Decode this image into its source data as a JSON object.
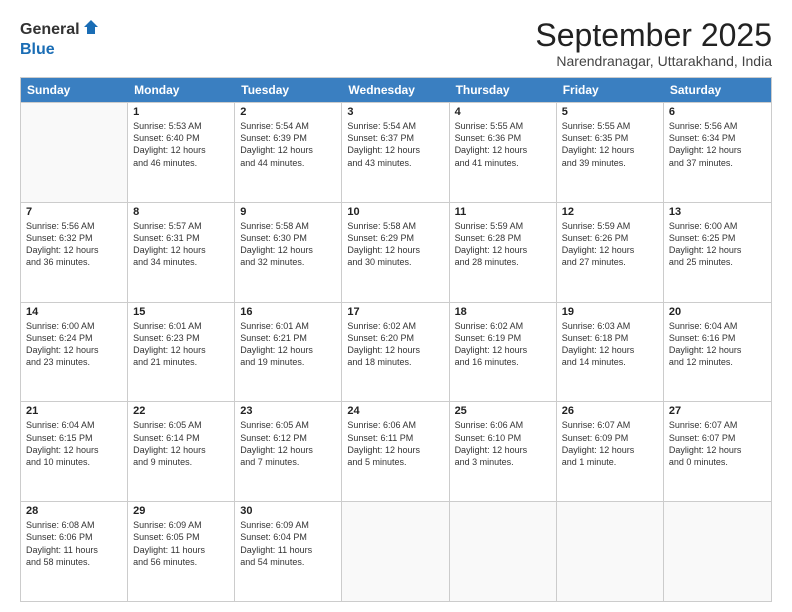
{
  "logo": {
    "general": "General",
    "blue": "Blue"
  },
  "title": "September 2025",
  "location": "Narendranagar, Uttarakhand, India",
  "headers": [
    "Sunday",
    "Monday",
    "Tuesday",
    "Wednesday",
    "Thursday",
    "Friday",
    "Saturday"
  ],
  "weeks": [
    [
      {
        "day": "",
        "info": ""
      },
      {
        "day": "1",
        "info": "Sunrise: 5:53 AM\nSunset: 6:40 PM\nDaylight: 12 hours\nand 46 minutes."
      },
      {
        "day": "2",
        "info": "Sunrise: 5:54 AM\nSunset: 6:39 PM\nDaylight: 12 hours\nand 44 minutes."
      },
      {
        "day": "3",
        "info": "Sunrise: 5:54 AM\nSunset: 6:37 PM\nDaylight: 12 hours\nand 43 minutes."
      },
      {
        "day": "4",
        "info": "Sunrise: 5:55 AM\nSunset: 6:36 PM\nDaylight: 12 hours\nand 41 minutes."
      },
      {
        "day": "5",
        "info": "Sunrise: 5:55 AM\nSunset: 6:35 PM\nDaylight: 12 hours\nand 39 minutes."
      },
      {
        "day": "6",
        "info": "Sunrise: 5:56 AM\nSunset: 6:34 PM\nDaylight: 12 hours\nand 37 minutes."
      }
    ],
    [
      {
        "day": "7",
        "info": "Sunrise: 5:56 AM\nSunset: 6:32 PM\nDaylight: 12 hours\nand 36 minutes."
      },
      {
        "day": "8",
        "info": "Sunrise: 5:57 AM\nSunset: 6:31 PM\nDaylight: 12 hours\nand 34 minutes."
      },
      {
        "day": "9",
        "info": "Sunrise: 5:58 AM\nSunset: 6:30 PM\nDaylight: 12 hours\nand 32 minutes."
      },
      {
        "day": "10",
        "info": "Sunrise: 5:58 AM\nSunset: 6:29 PM\nDaylight: 12 hours\nand 30 minutes."
      },
      {
        "day": "11",
        "info": "Sunrise: 5:59 AM\nSunset: 6:28 PM\nDaylight: 12 hours\nand 28 minutes."
      },
      {
        "day": "12",
        "info": "Sunrise: 5:59 AM\nSunset: 6:26 PM\nDaylight: 12 hours\nand 27 minutes."
      },
      {
        "day": "13",
        "info": "Sunrise: 6:00 AM\nSunset: 6:25 PM\nDaylight: 12 hours\nand 25 minutes."
      }
    ],
    [
      {
        "day": "14",
        "info": "Sunrise: 6:00 AM\nSunset: 6:24 PM\nDaylight: 12 hours\nand 23 minutes."
      },
      {
        "day": "15",
        "info": "Sunrise: 6:01 AM\nSunset: 6:23 PM\nDaylight: 12 hours\nand 21 minutes."
      },
      {
        "day": "16",
        "info": "Sunrise: 6:01 AM\nSunset: 6:21 PM\nDaylight: 12 hours\nand 19 minutes."
      },
      {
        "day": "17",
        "info": "Sunrise: 6:02 AM\nSunset: 6:20 PM\nDaylight: 12 hours\nand 18 minutes."
      },
      {
        "day": "18",
        "info": "Sunrise: 6:02 AM\nSunset: 6:19 PM\nDaylight: 12 hours\nand 16 minutes."
      },
      {
        "day": "19",
        "info": "Sunrise: 6:03 AM\nSunset: 6:18 PM\nDaylight: 12 hours\nand 14 minutes."
      },
      {
        "day": "20",
        "info": "Sunrise: 6:04 AM\nSunset: 6:16 PM\nDaylight: 12 hours\nand 12 minutes."
      }
    ],
    [
      {
        "day": "21",
        "info": "Sunrise: 6:04 AM\nSunset: 6:15 PM\nDaylight: 12 hours\nand 10 minutes."
      },
      {
        "day": "22",
        "info": "Sunrise: 6:05 AM\nSunset: 6:14 PM\nDaylight: 12 hours\nand 9 minutes."
      },
      {
        "day": "23",
        "info": "Sunrise: 6:05 AM\nSunset: 6:12 PM\nDaylight: 12 hours\nand 7 minutes."
      },
      {
        "day": "24",
        "info": "Sunrise: 6:06 AM\nSunset: 6:11 PM\nDaylight: 12 hours\nand 5 minutes."
      },
      {
        "day": "25",
        "info": "Sunrise: 6:06 AM\nSunset: 6:10 PM\nDaylight: 12 hours\nand 3 minutes."
      },
      {
        "day": "26",
        "info": "Sunrise: 6:07 AM\nSunset: 6:09 PM\nDaylight: 12 hours\nand 1 minute."
      },
      {
        "day": "27",
        "info": "Sunrise: 6:07 AM\nSunset: 6:07 PM\nDaylight: 12 hours\nand 0 minutes."
      }
    ],
    [
      {
        "day": "28",
        "info": "Sunrise: 6:08 AM\nSunset: 6:06 PM\nDaylight: 11 hours\nand 58 minutes."
      },
      {
        "day": "29",
        "info": "Sunrise: 6:09 AM\nSunset: 6:05 PM\nDaylight: 11 hours\nand 56 minutes."
      },
      {
        "day": "30",
        "info": "Sunrise: 6:09 AM\nSunset: 6:04 PM\nDaylight: 11 hours\nand 54 minutes."
      },
      {
        "day": "",
        "info": ""
      },
      {
        "day": "",
        "info": ""
      },
      {
        "day": "",
        "info": ""
      },
      {
        "day": "",
        "info": ""
      }
    ]
  ]
}
